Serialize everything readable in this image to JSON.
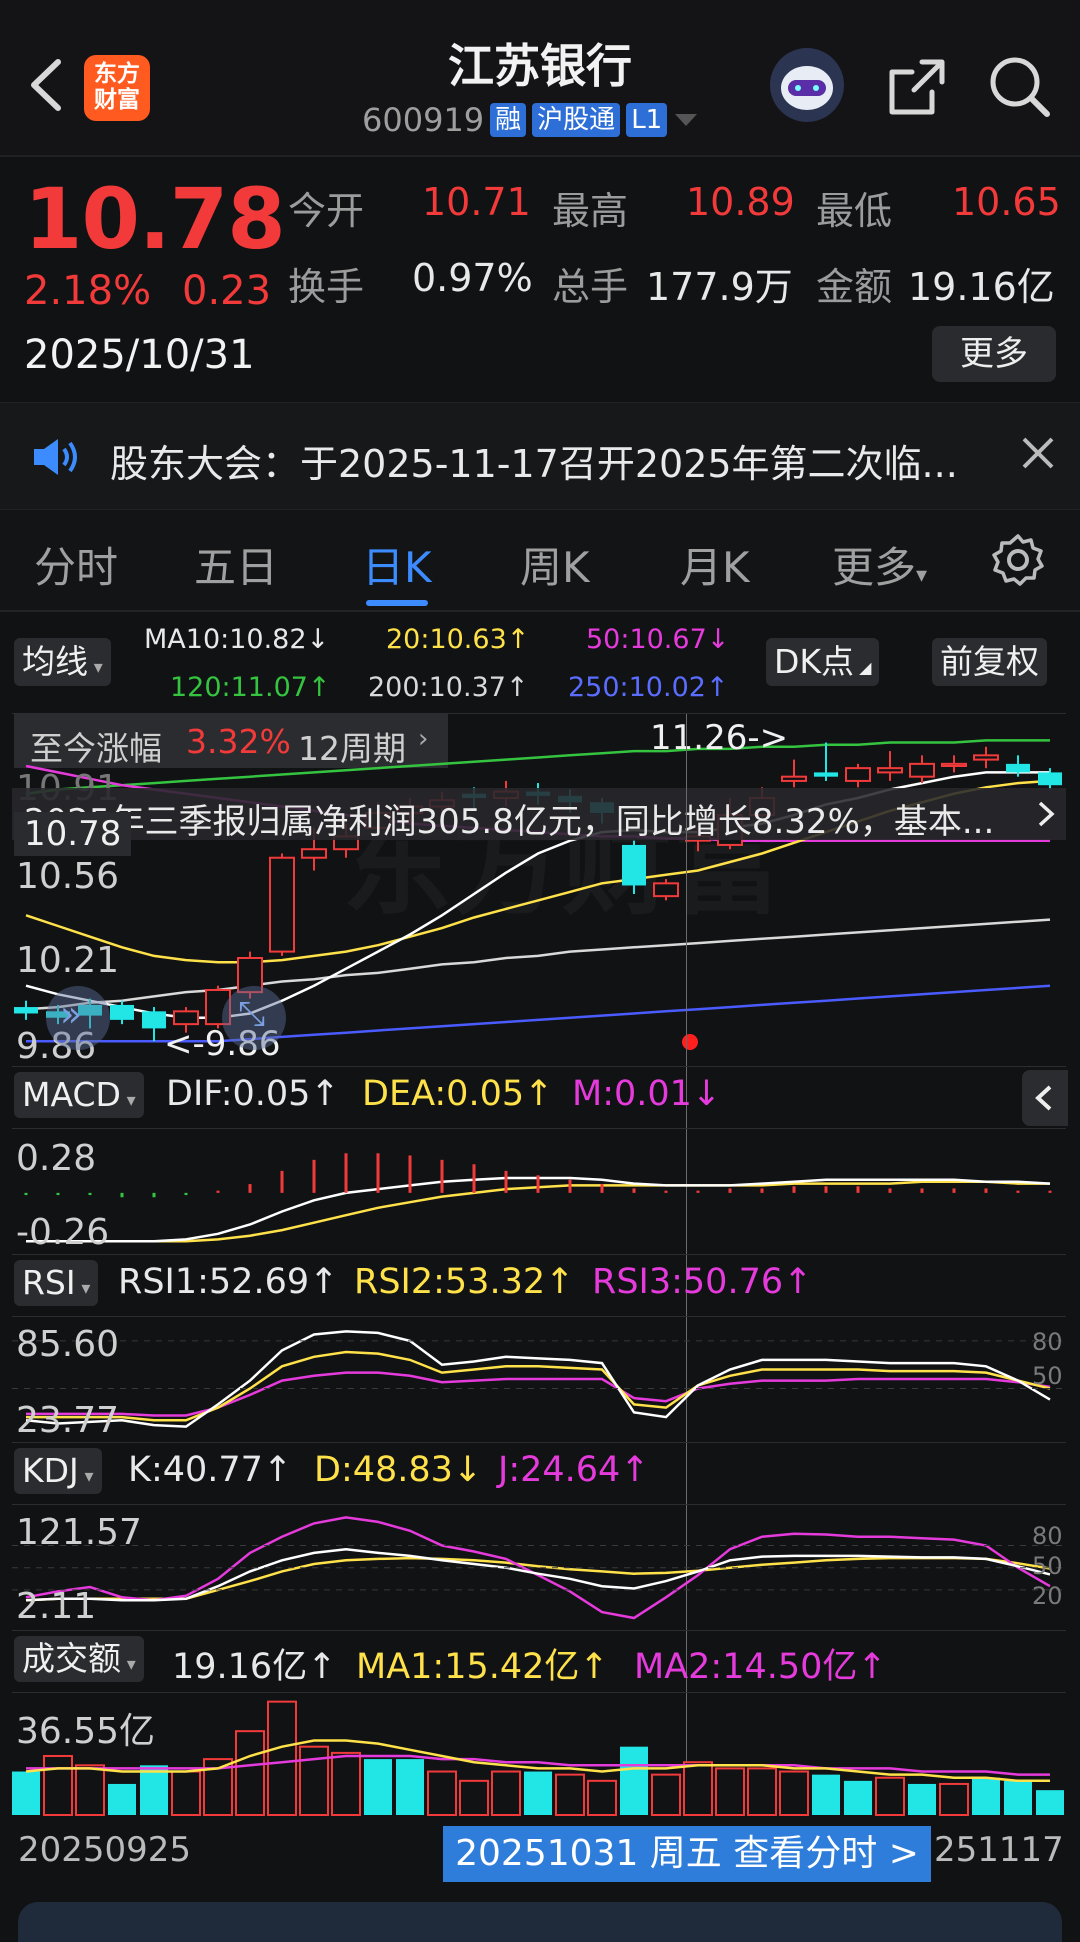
{
  "header": {
    "stock_name": "江苏银行",
    "code": "600919",
    "tags": [
      "融",
      "沪股通",
      "L1"
    ],
    "logo_line1": "东方",
    "logo_line2": "财富"
  },
  "quote": {
    "price": "10.78",
    "pct": "2.18%",
    "change": "0.23",
    "date": "2025/10/31",
    "open_label": "今开",
    "open": "10.71",
    "high_label": "最高",
    "high": "10.89",
    "low_label": "最低",
    "low": "10.65",
    "turnover_label": "换手",
    "turnover": "0.97%",
    "volume_label": "总手",
    "volume": "177.9万",
    "amount_label": "金额",
    "amount": "19.16亿",
    "more_label": "更多"
  },
  "notice": {
    "text": "股东大会：于2025-11-17召开2025年第二次临..."
  },
  "tabs": [
    {
      "label": "分时"
    },
    {
      "label": "五日"
    },
    {
      "label": "日K"
    },
    {
      "label": "周K"
    },
    {
      "label": "月K"
    },
    {
      "label": "更多"
    }
  ],
  "active_tab": "日K",
  "ma_bar": {
    "selector": "均线",
    "ma10": "MA10:10.82↓",
    "ma20": "20:10.63↑",
    "ma50": "50:10.67↓",
    "ma120": "120:11.07↑",
    "ma200": "200:10.37↑",
    "ma250": "250:10.02↑",
    "dk_label": "DK点",
    "adjust_label": "前复权"
  },
  "kline": {
    "period_label": "至今涨幅",
    "period_pct": "3.32%",
    "period_cycles": "12周期",
    "max_marker": "11.26->",
    "min_marker": "<-9.86",
    "news": "2025年三季报归属净利润305.8亿元，同比增长8.32%，基本...",
    "y_labels": [
      "10.91",
      "10.56",
      "10.21",
      "9.86"
    ],
    "current_price_tag": "10.78",
    "watermark": "东方财富",
    "candles": [
      {
        "o": 10.02,
        "c": 9.99,
        "h": 10.05,
        "l": 9.96
      },
      {
        "o": 10.0,
        "c": 9.97,
        "h": 10.03,
        "l": 9.94
      },
      {
        "o": 10.03,
        "c": 9.98,
        "h": 10.06,
        "l": 9.92
      },
      {
        "o": 10.03,
        "c": 9.96,
        "h": 10.05,
        "l": 9.94
      },
      {
        "o": 10.0,
        "c": 9.92,
        "h": 10.02,
        "l": 9.86
      },
      {
        "o": 9.94,
        "c": 10.0,
        "h": 10.02,
        "l": 9.9
      },
      {
        "o": 9.94,
        "c": 10.1,
        "h": 10.12,
        "l": 9.92
      },
      {
        "o": 10.09,
        "c": 10.25,
        "h": 10.28,
        "l": 10.06
      },
      {
        "o": 10.28,
        "c": 10.72,
        "h": 10.74,
        "l": 10.26
      },
      {
        "o": 10.72,
        "c": 10.76,
        "h": 10.86,
        "l": 10.66
      },
      {
        "o": 10.76,
        "c": 10.82,
        "h": 10.88,
        "l": 10.72
      },
      {
        "o": 10.86,
        "c": 10.93,
        "h": 10.98,
        "l": 10.82
      },
      {
        "o": 10.93,
        "c": 10.96,
        "h": 11.0,
        "l": 10.88
      },
      {
        "o": 10.96,
        "c": 10.99,
        "h": 11.03,
        "l": 10.9
      },
      {
        "o": 11.02,
        "c": 11.0,
        "h": 11.05,
        "l": 10.95
      },
      {
        "o": 11.0,
        "c": 11.03,
        "h": 11.08,
        "l": 10.96
      },
      {
        "o": 11.03,
        "c": 11.01,
        "h": 11.07,
        "l": 10.97
      },
      {
        "o": 11.01,
        "c": 10.98,
        "h": 11.04,
        "l": 10.93
      },
      {
        "o": 10.98,
        "c": 10.93,
        "h": 11.0,
        "l": 10.88
      },
      {
        "o": 10.78,
        "c": 10.59,
        "h": 10.8,
        "l": 10.55
      },
      {
        "o": 10.54,
        "c": 10.6,
        "h": 10.62,
        "l": 10.52
      },
      {
        "o": 10.8,
        "c": 10.82,
        "h": 10.86,
        "l": 10.75
      },
      {
        "o": 10.78,
        "c": 10.92,
        "h": 11.0,
        "l": 10.76
      },
      {
        "o": 10.92,
        "c": 11.0,
        "h": 11.05,
        "l": 10.9
      },
      {
        "o": 11.08,
        "c": 11.1,
        "h": 11.18,
        "l": 11.05
      },
      {
        "o": 11.12,
        "c": 11.1,
        "h": 11.26,
        "l": 11.08
      },
      {
        "o": 11.08,
        "c": 11.14,
        "h": 11.16,
        "l": 11.05
      },
      {
        "o": 11.12,
        "c": 11.14,
        "h": 11.22,
        "l": 11.08
      },
      {
        "o": 11.1,
        "c": 11.16,
        "h": 11.2,
        "l": 11.07
      },
      {
        "o": 11.15,
        "c": 11.16,
        "h": 11.2,
        "l": 11.12
      },
      {
        "o": 11.18,
        "c": 11.2,
        "h": 11.24,
        "l": 11.14
      },
      {
        "o": 11.16,
        "c": 11.12,
        "h": 11.2,
        "l": 11.1
      },
      {
        "o": 11.12,
        "c": 11.06,
        "h": 11.14,
        "l": 11.04
      }
    ],
    "ma_lines": {
      "ma10": [
        10.12,
        10.08,
        10.05,
        10.02,
        9.99,
        9.97,
        9.97,
        9.99,
        10.05,
        10.12,
        10.2,
        10.28,
        10.36,
        10.45,
        10.55,
        10.65,
        10.74,
        10.8,
        10.84,
        10.85,
        10.84,
        10.84,
        10.86,
        10.88,
        10.92,
        10.97,
        11.0,
        11.04,
        11.07,
        11.1,
        11.12,
        11.12,
        11.12
      ],
      "ma20": [
        10.45,
        10.4,
        10.35,
        10.3,
        10.26,
        10.24,
        10.23,
        10.23,
        10.24,
        10.26,
        10.28,
        10.31,
        10.35,
        10.39,
        10.44,
        10.48,
        10.52,
        10.56,
        10.6,
        10.62,
        10.64,
        10.66,
        10.7,
        10.74,
        10.79,
        10.84,
        10.89,
        10.94,
        10.98,
        11.02,
        11.05,
        11.07,
        11.08
      ],
      "ma50": [
        11.15,
        11.12,
        11.09,
        11.06,
        11.04,
        11.02,
        11.0,
        10.98,
        10.96,
        10.94,
        10.92,
        10.9,
        10.88,
        10.87,
        10.86,
        10.85,
        10.84,
        10.83,
        10.82,
        10.82,
        10.81,
        10.81,
        10.8,
        10.8,
        10.8,
        10.8,
        10.8,
        10.8,
        10.8,
        10.8,
        10.8,
        10.8,
        10.8
      ],
      "ma120": [
        11.02,
        11.04,
        11.05,
        11.06,
        11.07,
        11.08,
        11.09,
        11.1,
        11.11,
        11.12,
        11.13,
        11.14,
        11.15,
        11.16,
        11.17,
        11.18,
        11.19,
        11.2,
        11.21,
        11.22,
        11.22,
        11.23,
        11.23,
        11.24,
        11.24,
        11.25,
        11.25,
        11.26,
        11.26,
        11.26,
        11.27,
        11.27,
        11.27
      ],
      "ma200": [
        10.01,
        10.02,
        10.04,
        10.05,
        10.07,
        10.09,
        10.1,
        10.12,
        10.14,
        10.15,
        10.17,
        10.18,
        10.2,
        10.22,
        10.23,
        10.25,
        10.26,
        10.28,
        10.29,
        10.3,
        10.31,
        10.32,
        10.33,
        10.34,
        10.35,
        10.36,
        10.37,
        10.38,
        10.39,
        10.4,
        10.41,
        10.42,
        10.43
      ],
      "ma250": [
        9.86,
        9.86,
        9.86,
        9.86,
        9.86,
        9.86,
        9.86,
        9.87,
        9.88,
        9.89,
        9.9,
        9.91,
        9.92,
        9.93,
        9.94,
        9.95,
        9.96,
        9.97,
        9.98,
        9.99,
        10.0,
        10.01,
        10.02,
        10.03,
        10.04,
        10.05,
        10.06,
        10.07,
        10.08,
        10.09,
        10.1,
        10.11,
        10.12
      ]
    },
    "colors": {
      "up": "#f23a3a",
      "down": "#22e6e6",
      "ma10": "#ffffff",
      "ma20": "#ffe14a",
      "ma50": "#e63bdc",
      "ma120": "#35c440",
      "ma200": "#d9d9d9",
      "ma250": "#4a5bff"
    }
  },
  "macd": {
    "label": "MACD",
    "dif": "DIF:0.05↑",
    "dea": "DEA:0.05↑",
    "m": "M:0.01↓",
    "y_labels": [
      "0.28",
      "-0.26"
    ],
    "bars": [
      -0.01,
      -0.01,
      -0.01,
      -0.02,
      -0.02,
      -0.01,
      0.01,
      0.04,
      0.1,
      0.15,
      0.18,
      0.18,
      0.17,
      0.15,
      0.13,
      0.1,
      0.08,
      0.06,
      0.04,
      0.02,
      0.01,
      0.01,
      0.02,
      0.02,
      0.03,
      0.03,
      0.03,
      0.02,
      0.02,
      0.02,
      0.02,
      0.01,
      0.01
    ],
    "dif_line": [
      -0.26,
      -0.26,
      -0.26,
      -0.26,
      -0.26,
      -0.25,
      -0.22,
      -0.17,
      -0.1,
      -0.04,
      0.0,
      0.02,
      0.04,
      0.06,
      0.07,
      0.08,
      0.08,
      0.08,
      0.07,
      0.05,
      0.04,
      0.04,
      0.04,
      0.05,
      0.06,
      0.07,
      0.07,
      0.07,
      0.07,
      0.07,
      0.06,
      0.06,
      0.05
    ],
    "dea_line": [
      -0.26,
      -0.26,
      -0.26,
      -0.26,
      -0.26,
      -0.26,
      -0.25,
      -0.23,
      -0.2,
      -0.16,
      -0.12,
      -0.08,
      -0.05,
      -0.02,
      0.0,
      0.02,
      0.03,
      0.04,
      0.04,
      0.04,
      0.04,
      0.04,
      0.04,
      0.04,
      0.05,
      0.05,
      0.05,
      0.05,
      0.06,
      0.06,
      0.06,
      0.05,
      0.05
    ]
  },
  "rsi": {
    "label": "RSI",
    "rsi1": "RSI1:52.69↑",
    "rsi2": "RSI2:53.32↑",
    "rsi3": "RSI3:50.76↑",
    "y_labels": [
      "85.60",
      "23.77"
    ],
    "right_labels": [
      "80",
      "50"
    ],
    "rsi1_line": [
      30,
      28,
      29,
      30,
      27,
      26,
      40,
      55,
      74,
      84,
      86,
      85,
      80,
      65,
      67,
      70,
      69,
      68,
      66,
      35,
      32,
      52,
      62,
      68,
      68,
      68,
      67,
      66,
      66,
      66,
      64,
      55,
      43
    ],
    "rsi2_line": [
      32,
      32,
      32,
      32,
      30,
      30,
      38,
      50,
      64,
      70,
      73,
      72,
      68,
      60,
      62,
      64,
      64,
      63,
      62,
      40,
      38,
      52,
      58,
      62,
      62,
      62,
      62,
      61,
      61,
      61,
      60,
      55,
      50
    ],
    "rsi3_line": [
      34,
      34,
      34,
      34,
      33,
      33,
      38,
      46,
      55,
      58,
      60,
      60,
      58,
      54,
      55,
      56,
      56,
      56,
      56,
      44,
      42,
      50,
      53,
      55,
      55,
      55,
      56,
      56,
      56,
      56,
      56,
      54,
      51
    ]
  },
  "kdj": {
    "label": "KDJ",
    "k": "K:40.77↑",
    "d": "D:48.83↓",
    "j": "J:24.64↑",
    "y_labels": [
      "121.57",
      "2.11"
    ],
    "right_labels": [
      "80",
      "50",
      "20"
    ],
    "k_line": [
      6,
      8,
      8,
      6,
      6,
      8,
      25,
      45,
      60,
      70,
      75,
      70,
      66,
      60,
      55,
      50,
      42,
      35,
      25,
      22,
      32,
      45,
      60,
      65,
      66,
      66,
      66,
      65,
      64,
      64,
      62,
      52,
      41
    ],
    "d_line": [
      6,
      8,
      8,
      8,
      8,
      8,
      20,
      32,
      45,
      55,
      60,
      62,
      63,
      62,
      60,
      57,
      52,
      48,
      45,
      42,
      43,
      46,
      50,
      54,
      57,
      60,
      62,
      63,
      63,
      63,
      62,
      56,
      49
    ],
    "j_line": [
      10,
      18,
      24,
      10,
      6,
      12,
      35,
      70,
      92,
      110,
      118,
      112,
      100,
      80,
      72,
      62,
      40,
      18,
      -10,
      -18,
      10,
      40,
      75,
      92,
      96,
      95,
      92,
      92,
      90,
      88,
      80,
      50,
      25
    ]
  },
  "amount": {
    "label": "成交额",
    "value": "19.16亿↑",
    "ma1": "MA1:15.42亿↑",
    "ma2": "MA2:14.50亿↑",
    "y_labels": [
      "36.55亿"
    ],
    "bars": [
      {
        "v": 14,
        "d": "down"
      },
      {
        "v": 19,
        "d": "up"
      },
      {
        "v": 16,
        "d": "up"
      },
      {
        "v": 10,
        "d": "down"
      },
      {
        "v": 16,
        "d": "down"
      },
      {
        "v": 14,
        "d": "up"
      },
      {
        "v": 18,
        "d": "up"
      },
      {
        "v": 27,
        "d": "up"
      },
      {
        "v": 36.5,
        "d": "up"
      },
      {
        "v": 22,
        "d": "up"
      },
      {
        "v": 20,
        "d": "up"
      },
      {
        "v": 18,
        "d": "down"
      },
      {
        "v": 18,
        "d": "down"
      },
      {
        "v": 14,
        "d": "up"
      },
      {
        "v": 11,
        "d": "up"
      },
      {
        "v": 14,
        "d": "up"
      },
      {
        "v": 14,
        "d": "down"
      },
      {
        "v": 13,
        "d": "up"
      },
      {
        "v": 11,
        "d": "up"
      },
      {
        "v": 22,
        "d": "down"
      },
      {
        "v": 13,
        "d": "up"
      },
      {
        "v": 17,
        "d": "up"
      },
      {
        "v": 15,
        "d": "up"
      },
      {
        "v": 15,
        "d": "up"
      },
      {
        "v": 14,
        "d": "up"
      },
      {
        "v": 13,
        "d": "down"
      },
      {
        "v": 11,
        "d": "down"
      },
      {
        "v": 12,
        "d": "up"
      },
      {
        "v": 10,
        "d": "down"
      },
      {
        "v": 10,
        "d": "up"
      },
      {
        "v": 12,
        "d": "down"
      },
      {
        "v": 11,
        "d": "down"
      },
      {
        "v": 8,
        "d": "down"
      }
    ],
    "ma1_line": [
      14,
      15,
      15,
      14,
      14,
      14,
      15,
      19,
      22,
      24,
      24,
      23,
      21,
      19,
      17,
      16,
      15,
      15,
      14,
      15,
      15,
      16,
      16,
      16,
      15,
      15,
      14,
      13,
      13,
      12,
      12,
      11,
      11
    ],
    "ma2_line": [
      15,
      15,
      15,
      15,
      15,
      15,
      15,
      16,
      17,
      18,
      19,
      19,
      19,
      18,
      18,
      17,
      17,
      16,
      16,
      16,
      16,
      16,
      16,
      16,
      16,
      15,
      15,
      15,
      14,
      14,
      14,
      13,
      13
    ]
  },
  "footer": {
    "start_date": "20250925",
    "cursor_label": "20251031 周五 查看分时 >",
    "end_date": "251117"
  }
}
